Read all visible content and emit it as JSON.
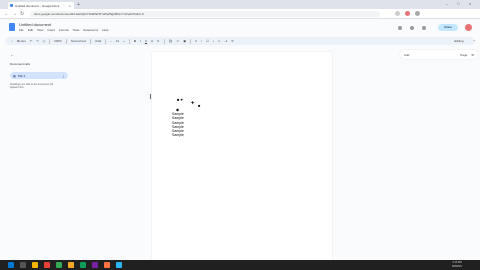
{
  "browser": {
    "tab_title": "Untitled document - Google Docs",
    "tab_close": "×",
    "new_tab": "+",
    "url": "docs.google.com/document/d/1Hw4qXc7J2k8f2r3TmPqZ5gN8bLvYx0/edit?tab=t.0",
    "minimize": "–",
    "maximize": "□",
    "close": "×"
  },
  "doc": {
    "title": "Untitled document",
    "menu": [
      "File",
      "Edit",
      "View",
      "Insert",
      "Format",
      "Tools",
      "Extensions",
      "Help"
    ],
    "share_label": "Share"
  },
  "toolbar": {
    "search": "Menus",
    "zoom": "100%",
    "style": "Normal text",
    "font": "Arial",
    "font_size": "11",
    "editing": "Editing"
  },
  "sidebar": {
    "title": "Document tabs",
    "tab_label": "Tab 1",
    "tab_more": "⋮",
    "hint": "Headings you add to the document will appear here."
  },
  "right_panel": {
    "label": "Add",
    "page": "Page"
  },
  "page": {
    "symbols": [
      {
        "text": "■ ♥"
      },
      {
        "text": "✚"
      },
      {
        "text": "■"
      },
      {
        "text": "◆"
      }
    ],
    "lines": [
      "Sample",
      "Sample",
      "Sample",
      "Sample",
      "Sample",
      "Sample"
    ]
  },
  "taskbar": {
    "time": "4:13 PM",
    "date": "6/6/2024",
    "icon_colors": [
      "#0078d4",
      "#f4b400",
      "#e94235",
      "#34a853",
      "#f9a825",
      "#0f9d58",
      "#7b1fa2",
      "#ff7043",
      "#29b6f6"
    ]
  }
}
